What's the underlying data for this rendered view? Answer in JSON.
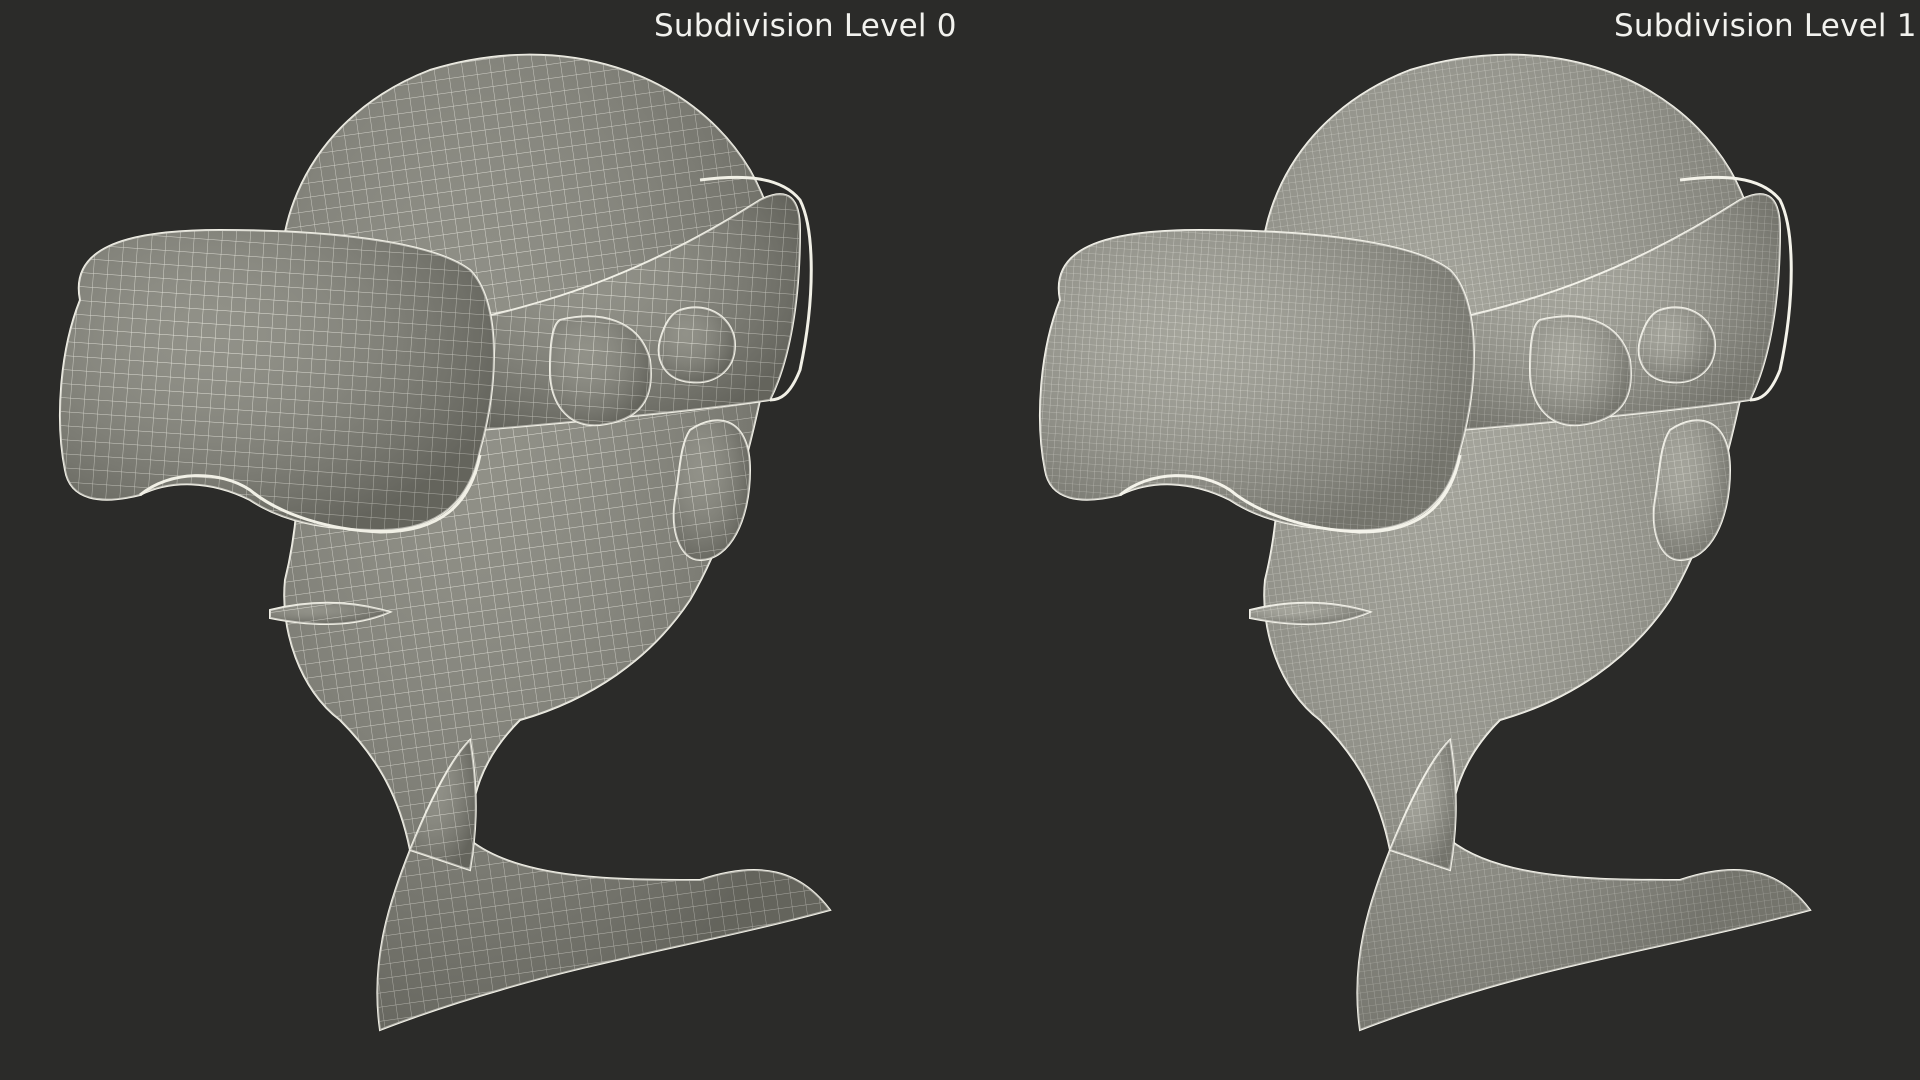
{
  "panels": [
    {
      "label": "Subdivision Level 0",
      "subdivision_level": 0,
      "wire_spacing_hint": "coarse",
      "surface_color": "#85857b",
      "wire_color": "#f1f0e6"
    },
    {
      "label": "Subdivision Level 1",
      "subdivision_level": 1,
      "wire_spacing_hint": "fine",
      "surface_color": "#9a9a90",
      "wire_color": "#f4f3ea"
    }
  ],
  "background_color": "#2b2b29"
}
